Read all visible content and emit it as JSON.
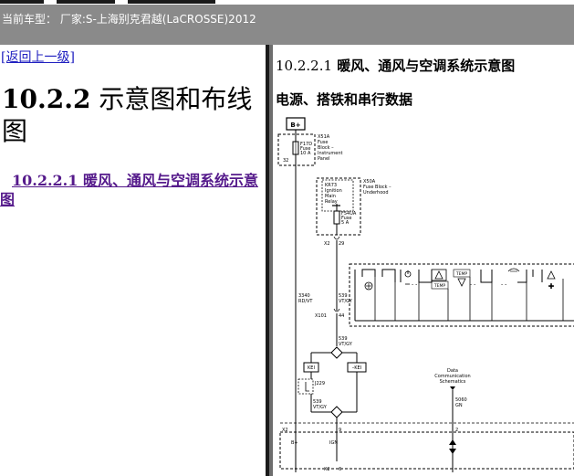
{
  "header": {
    "title": "当前车型： 厂家:S-上海别克君越(LaCROSSE)2012"
  },
  "left": {
    "back_link": "[返回上一级]",
    "section_number": "10.2.2",
    "section_title": " 示意图和布线图",
    "sub_link": "10.2.2.1 暖风、通风与空调系统示意图"
  },
  "right": {
    "heading_number": "10.2.2.1",
    "heading_text": " 暖风、通风与空调系统示意图",
    "subheading": "电源、搭铁和串行数据"
  },
  "diagram": {
    "b_plus": "B+",
    "x51a": "X51A",
    "fuse_block_ip": [
      "Fuse",
      "Block –",
      "Instrument",
      "Panel"
    ],
    "f17d": "F17D",
    "fuse": "Fuse",
    "f17d_amp": "10 A",
    "pin_32": "32",
    "x50a": "X50A",
    "fuse_block_uh": [
      "Fuse Block –",
      "Underhood"
    ],
    "kr73": [
      "KR73",
      "Ignition",
      "Main",
      "Relay"
    ],
    "f54ua": "F54UA",
    "f54ua_amp": "5 A",
    "x2": "X2",
    "pin_29": "29",
    "wire_3340": "3340",
    "wire_3340_color": "RD/VT",
    "wire_539": "539",
    "wire_539_color": "VT/GY",
    "x101": "X101",
    "pin_44": "44",
    "kb1": "KEI",
    "kb2": "–KEI",
    "j229": "J229",
    "data_comm": [
      "Data",
      "Communication",
      "Schematics"
    ],
    "wire_5060": "5060",
    "wire_5060_color": "GN",
    "temp": "TEMP",
    "pin_9": "9",
    "pin_2": "2",
    "pin_6": "6",
    "ign": "IGN"
  }
}
